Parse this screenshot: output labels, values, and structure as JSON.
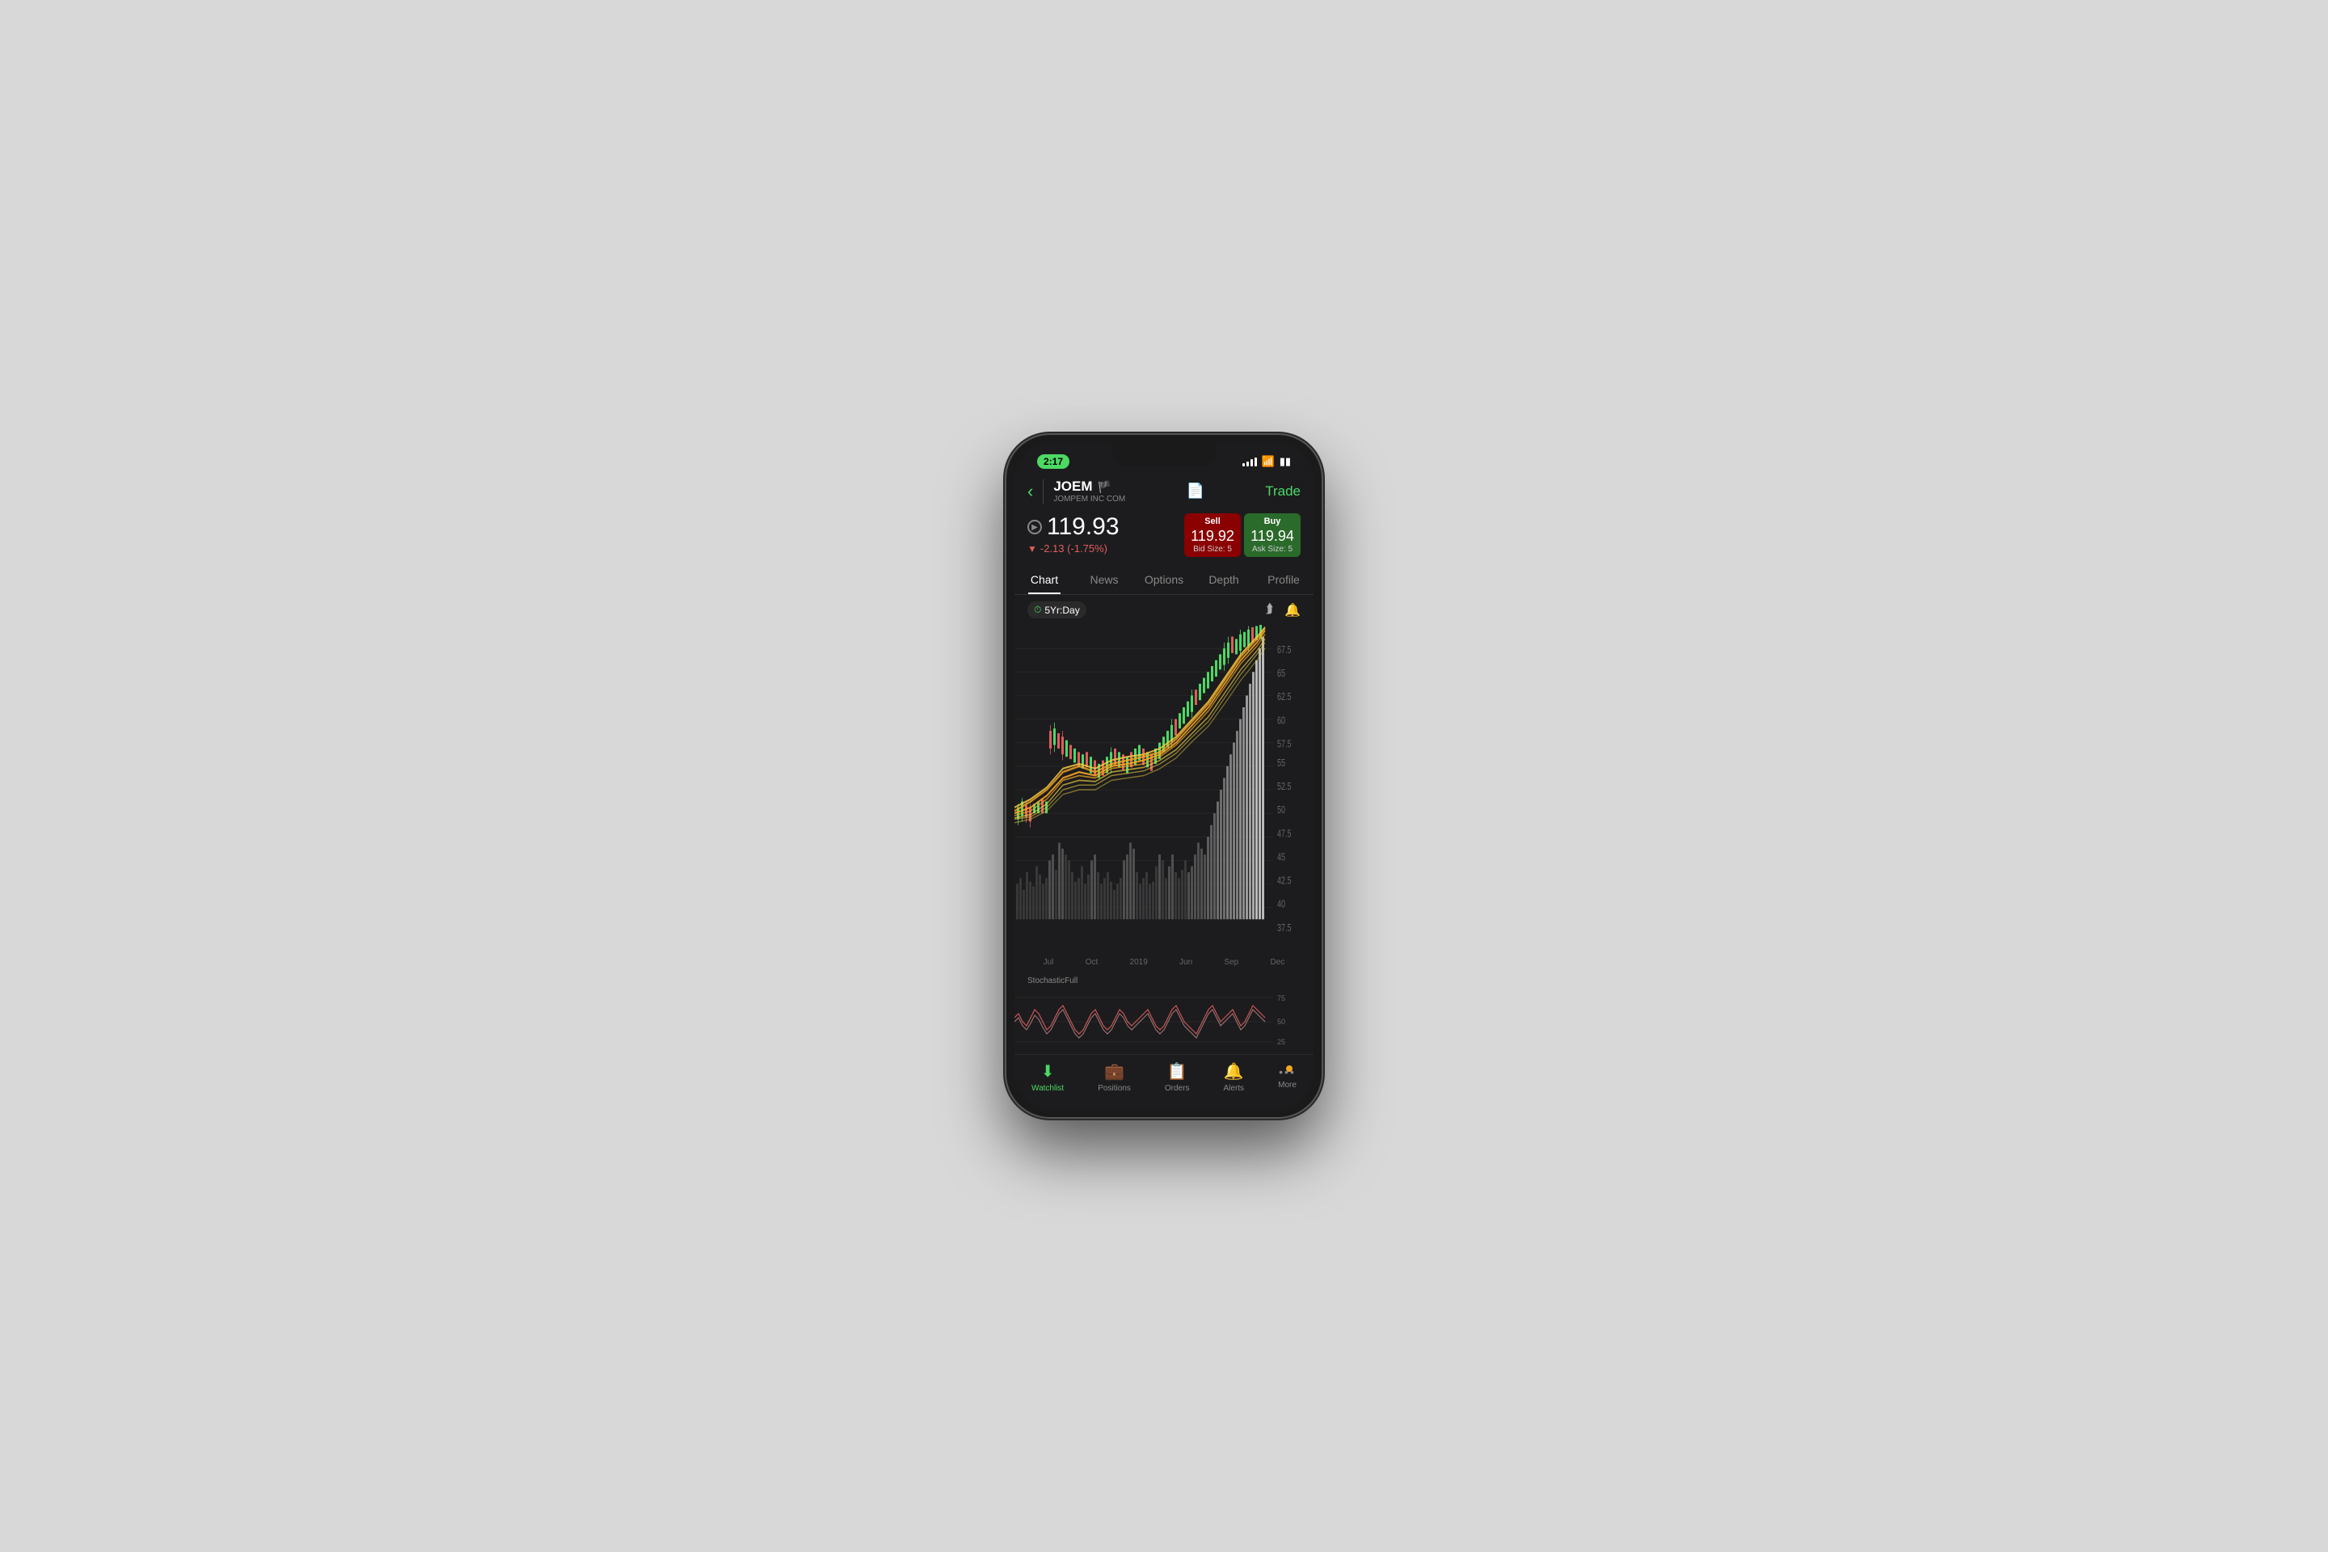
{
  "status_bar": {
    "time": "2:17",
    "signal_bars": [
      3,
      5,
      7,
      9
    ],
    "battery": "🔋"
  },
  "header": {
    "ticker_symbol": "JOEM",
    "ticker_full_name": "JOMPEM INC COM",
    "flag_icon": "🏴",
    "trade_label": "Trade"
  },
  "price": {
    "current": "119.93",
    "change": "-2.13 (-1.75%)",
    "sell_label": "Sell",
    "sell_price": "119.92",
    "sell_bid_size": "Bid Size: 5",
    "buy_label": "Buy",
    "buy_price": "119.94",
    "buy_ask_size": "Ask Size: 5"
  },
  "tabs": [
    {
      "label": "Chart",
      "active": true
    },
    {
      "label": "News",
      "active": false
    },
    {
      "label": "Options",
      "active": false
    },
    {
      "label": "Depth",
      "active": false
    },
    {
      "label": "Profile",
      "active": false
    }
  ],
  "chart_controls": {
    "timeframe": "5Yr:Day",
    "icons": [
      "share",
      "bell"
    ]
  },
  "chart": {
    "y_labels": [
      "67.5",
      "65",
      "62.5",
      "60",
      "57.5",
      "55",
      "52.5",
      "50",
      "47.5",
      "45",
      "42.5",
      "40",
      "37.5"
    ],
    "x_labels": [
      "Jul",
      "Oct",
      "2019",
      "Jun",
      "Sep",
      "Dec"
    ]
  },
  "indicator": {
    "name": "StochasticFull",
    "levels": [
      "75",
      "50",
      "25"
    ]
  },
  "bottom_nav": [
    {
      "label": "Watchlist",
      "icon": "📋",
      "active": true
    },
    {
      "label": "Positions",
      "icon": "💼",
      "active": false
    },
    {
      "label": "Orders",
      "icon": "📄",
      "active": false
    },
    {
      "label": "Alerts",
      "icon": "🔔",
      "active": false
    },
    {
      "label": "More",
      "icon": "•••",
      "active": false
    }
  ]
}
